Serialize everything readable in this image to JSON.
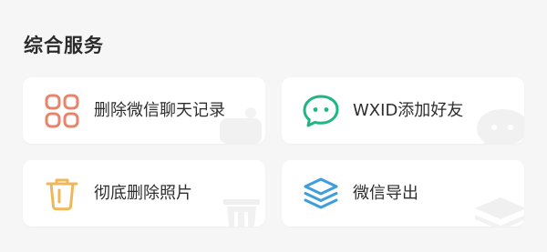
{
  "section": {
    "title": "综合服务"
  },
  "cards": [
    {
      "label": "删除微信聊天记录",
      "icon": "grid-icon",
      "color": "#e8846a"
    },
    {
      "label": "WXID添加好友",
      "icon": "chat-bubble-icon",
      "color": "#1fb584"
    },
    {
      "label": "彻底删除照片",
      "icon": "trash-icon",
      "color": "#f0b75a"
    },
    {
      "label": "微信导出",
      "icon": "layers-icon",
      "color": "#3d9ddd"
    }
  ]
}
